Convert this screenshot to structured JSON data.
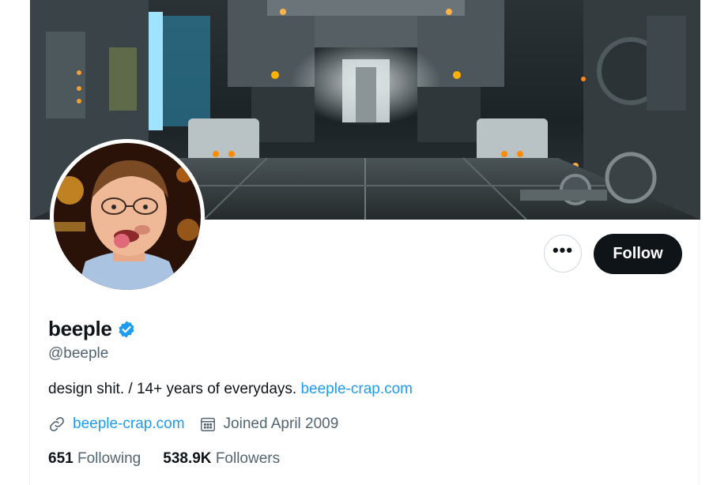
{
  "profile": {
    "display_name": "beeple",
    "handle": "@beeple",
    "bio_text": "design shit. / 14+ years of everydays. ",
    "bio_link": "beeple-crap.com",
    "website": "beeple-crap.com",
    "joined": "Joined April 2009",
    "following_count": "651",
    "following_label": "Following",
    "followers_count": "538.9K",
    "followers_label": "Followers"
  },
  "actions": {
    "more_icon": "more-horizontal-icon",
    "more_label": "•••",
    "follow_label": "Follow"
  },
  "icons": {
    "verified": "verified-badge-icon",
    "link": "link-icon",
    "calendar": "calendar-icon"
  },
  "colors": {
    "accent": "#1d9bf0",
    "text_primary": "#0f1419",
    "text_secondary": "#536471",
    "follow_bg": "#0f1419"
  }
}
